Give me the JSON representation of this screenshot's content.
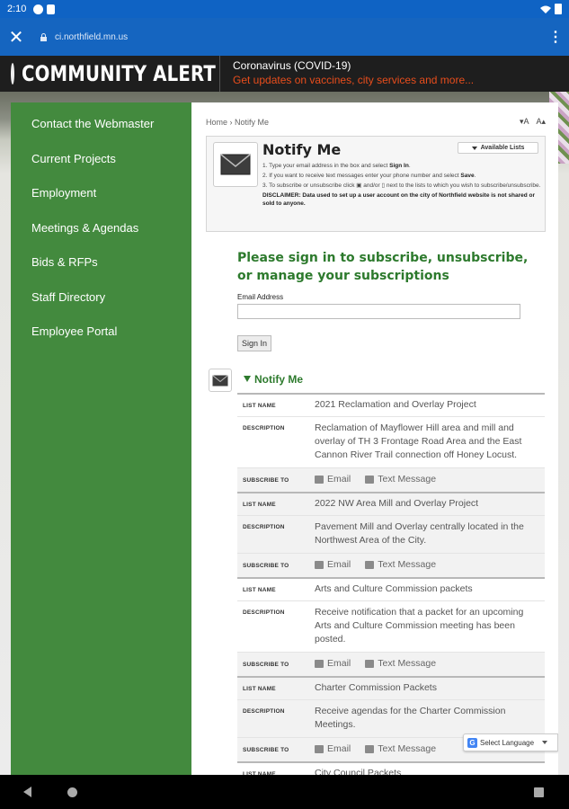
{
  "status_bar": {
    "time": "2:10"
  },
  "browser": {
    "url": "ci.northfield.mn.us",
    "close_glyph": "✕",
    "menu_glyph": "⋮"
  },
  "alert": {
    "title": "COMMUNITY ALERT",
    "topic": "Coronavirus (COVID-19)",
    "link": "Get updates on vaccines, city services and more..."
  },
  "sidebar": {
    "items": [
      {
        "label": "Contact the Webmaster"
      },
      {
        "label": "Current Projects"
      },
      {
        "label": "Employment"
      },
      {
        "label": "Meetings & Agendas"
      },
      {
        "label": "Bids & RFPs"
      },
      {
        "label": "Staff Directory"
      },
      {
        "label": "Employee Portal"
      }
    ]
  },
  "page": {
    "breadcrumb_home": "Home",
    "breadcrumb_sep": "›",
    "breadcrumb_current": "Notify Me",
    "font_smaller": "▾A",
    "font_larger": "A▴",
    "box_title": "Notify Me",
    "available_lists": "Available Lists",
    "instr1_prefix": "1. Type your email address in the box and select ",
    "instr1_bold": "Sign In",
    "instr1_suffix": ".",
    "instr2_prefix": "2. If you want to receive text messages enter your phone number and select ",
    "instr2_bold": "Save",
    "instr2_suffix": ".",
    "instr3": "3. To subscribe or unsubscribe click ▣ and/or ▯ next to the lists to which you wish to subscribe/unsubscribe.",
    "disclaimer_bold": "DISCLAIMER: Data used to set up a user account on the city of Northfield website is not shared or sold to anyone.",
    "signin_heading": "Please sign in to subscribe, unsubscribe, or manage your subscriptions",
    "email_label": "Email Address",
    "email_value": "",
    "signin_button": "Sign In",
    "section_title": "Notify Me"
  },
  "labels": {
    "list_name": "LIST NAME",
    "description": "DESCRIPTION",
    "subscribe_to": "SUBSCRIBE TO",
    "email": "Email",
    "text_message": "Text Message"
  },
  "lists": [
    {
      "name": "2021 Reclamation and Overlay Project",
      "description": "Reclamation of Mayflower Hill area and mill and overlay of TH 3 Frontage Road Area and the East Cannon River Trail connection off Honey Locust."
    },
    {
      "name": "2022 NW Area Mill and Overlay Project",
      "description": "Pavement Mill and Overlay centrally located in the Northwest Area of the City."
    },
    {
      "name": "Arts and Culture Commission packets",
      "description": "Receive notification that a packet for an upcoming Arts and Culture Commission meeting has been posted."
    },
    {
      "name": "Charter Commission Packets",
      "description": "Receive agendas for the Charter Commission Meetings."
    },
    {
      "name": "City Council Packets"
    }
  ],
  "translate": {
    "label": "Select Language",
    "g": "G"
  },
  "colors": {
    "sidebar": "#438a3e",
    "heading_green": "#2d7a2d",
    "alert_link": "#e84d1c",
    "toolbar": "#1565c0"
  }
}
